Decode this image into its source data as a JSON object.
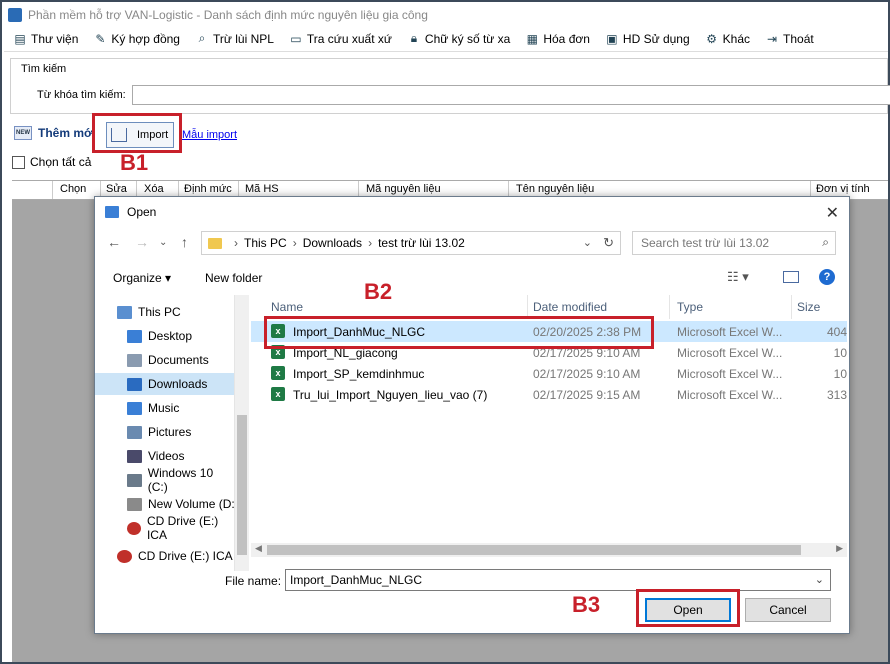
{
  "window": {
    "title": "Phần mềm hỗ trợ VAN-Logistic - Danh sách định mức nguyên liệu gia công"
  },
  "menu": [
    {
      "label": "Thư viện",
      "icon": "library-icon"
    },
    {
      "label": "Ký hợp đồng",
      "icon": "contract-icon"
    },
    {
      "label": "Trừ lùi NPL",
      "icon": "search-icon"
    },
    {
      "label": "Tra cứu xuất xứ",
      "icon": "document-icon"
    },
    {
      "label": "Chữ ký số từ xa",
      "icon": "lock-icon"
    },
    {
      "label": "Hóa đơn",
      "icon": "invoice-icon"
    },
    {
      "label": "HD Sử dụng",
      "icon": "help-icon"
    },
    {
      "label": "Khác",
      "icon": "gear-icon"
    },
    {
      "label": "Thoát",
      "icon": "exit-icon"
    }
  ],
  "search": {
    "legend": "Tìm kiếm",
    "label": "Từ khóa tìm kiếm:",
    "value": ""
  },
  "actions": {
    "add_label": "Thêm mới",
    "add_icon_text": "NEW",
    "import_label": "Import",
    "template_link": "Mẫu import"
  },
  "select_all_label": "Chọn tất cả",
  "grid": {
    "columns": [
      "Chọn",
      "Sửa",
      "Xóa",
      "Định mức",
      "Mã HS",
      "Mã nguyên liệu",
      "Tên nguyên liệu",
      "Đơn vị tính"
    ]
  },
  "annotations": {
    "b1": "B1",
    "b2": "B2",
    "b3": "B3"
  },
  "dialog": {
    "title": "Open",
    "breadcrumb": [
      "This PC",
      "Downloads",
      "test trừ lùi 13.02"
    ],
    "search_placeholder": "Search test trừ lùi 13.02",
    "organize_label": "Organize ▾",
    "new_folder_label": "New folder",
    "nav_items": [
      {
        "label": "This PC",
        "color": "#5a8fd0"
      },
      {
        "label": "Desktop",
        "color": "#3a7fd6"
      },
      {
        "label": "Documents",
        "color": "#8a9bb0"
      },
      {
        "label": "Downloads",
        "color": "#2a6bc0",
        "selected": true
      },
      {
        "label": "Music",
        "color": "#3a7fd6"
      },
      {
        "label": "Pictures",
        "color": "#6a8ab0"
      },
      {
        "label": "Videos",
        "color": "#4a4a6a"
      },
      {
        "label": "Windows 10 (C:)",
        "color": "#6a7a8a"
      },
      {
        "label": "New Volume (D:",
        "color": "#8a8a8a"
      },
      {
        "label": "CD Drive (E:) ICA",
        "color": "#c0302a"
      },
      {
        "label": "CD Drive (E:) ICA",
        "color": "#c0302a"
      }
    ],
    "columns": {
      "name": "Name",
      "date": "Date modified",
      "type": "Type",
      "size": "Size"
    },
    "files": [
      {
        "name": "Import_DanhMuc_NLGC",
        "date": "02/20/2025 2:38 PM",
        "type": "Microsoft Excel W...",
        "size": "404",
        "selected": true
      },
      {
        "name": "Import_NL_giacong",
        "date": "02/17/2025 9:10 AM",
        "type": "Microsoft Excel W...",
        "size": "10"
      },
      {
        "name": "Import_SP_kemdinhmuc",
        "date": "02/17/2025 9:10 AM",
        "type": "Microsoft Excel W...",
        "size": "10"
      },
      {
        "name": "Tru_lui_Import_Nguyen_lieu_vao (7)",
        "date": "02/17/2025 9:15 AM",
        "type": "Microsoft Excel W...",
        "size": "313"
      }
    ],
    "file_name_label": "File name:",
    "file_name_value": "Import_DanhMuc_NLGC",
    "open_label": "Open",
    "cancel_label": "Cancel"
  }
}
